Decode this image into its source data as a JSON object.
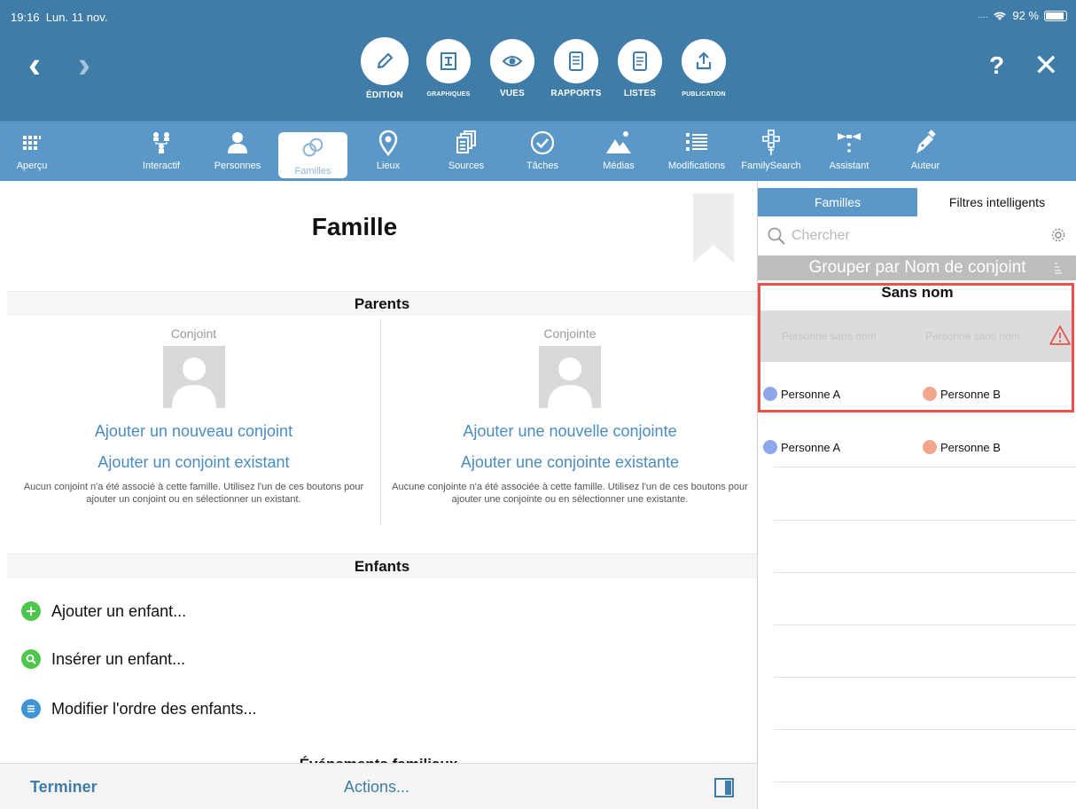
{
  "status": {
    "time": "19:16",
    "date": "Lun. 11 nov.",
    "battery": "92 %",
    "battery_level": 0.92
  },
  "header": {
    "modes": [
      {
        "label": "ÉDITION",
        "icon": "pencil-icon",
        "active": true
      },
      {
        "label": "GRAPHIQUES",
        "icon": "chart-icon",
        "active": false
      },
      {
        "label": "VUES",
        "icon": "eye-icon",
        "active": false
      },
      {
        "label": "RAPPORTS",
        "icon": "document-icon",
        "active": false
      },
      {
        "label": "LISTES",
        "icon": "list-document-icon",
        "active": false
      },
      {
        "label": "PUBLICATION",
        "icon": "share-icon",
        "active": false
      }
    ],
    "help": "?",
    "close": "✕"
  },
  "toolbar": {
    "items": [
      {
        "label": "Aperçu",
        "icon": "grid-icon"
      },
      {
        "label": "Interactif",
        "icon": "tree-icon"
      },
      {
        "label": "Personnes",
        "icon": "person-icon"
      },
      {
        "label": "Familles",
        "icon": "rings-icon",
        "active": true
      },
      {
        "label": "Lieux",
        "icon": "pin-icon"
      },
      {
        "label": "Sources",
        "icon": "sources-icon"
      },
      {
        "label": "Tâches",
        "icon": "check-icon"
      },
      {
        "label": "Médias",
        "icon": "media-icon"
      },
      {
        "label": "Modifications",
        "icon": "changes-icon"
      },
      {
        "label": "FamilySearch",
        "icon": "familysearch-icon"
      },
      {
        "label": "Assistant",
        "icon": "bowtie-icon"
      },
      {
        "label": "Auteur",
        "icon": "pen-icon"
      }
    ]
  },
  "main": {
    "title": "Famille",
    "parents_header": "Parents",
    "left": {
      "role": "Conjoint",
      "add_new": "Ajouter un nouveau conjoint",
      "add_existing": "Ajouter un conjoint existant",
      "hint": "Aucun conjoint n'a été associé à cette famille. Utilisez l'un de ces boutons pour ajouter un conjoint ou en sélectionner un existant."
    },
    "right": {
      "role": "Conjointe",
      "add_new": "Ajouter une nouvelle conjointe",
      "add_existing": "Ajouter une conjointe existante",
      "hint": "Aucune conjointe n'a été associée à cette famille. Utilisez l'un de ces boutons pour ajouter une conjointe ou en sélectionner une existante."
    },
    "children_header": "Enfants",
    "add_child": "Ajouter un enfant...",
    "insert_child": "Insérer un enfant...",
    "reorder_children": "Modifier l'ordre des enfants...",
    "events_header": "Événements familiaux"
  },
  "bottom": {
    "done": "Terminer",
    "actions": "Actions..."
  },
  "sidebar": {
    "tab_families": "Familles",
    "tab_filters": "Filtres intelligents",
    "search_placeholder": "Chercher",
    "group_by": "Grouper par Nom de conjoint",
    "group_title": "Sans nom",
    "unnamed_row": {
      "a": "Personne sans nom",
      "b": "Personne sans nom"
    },
    "rows": [
      {
        "a": "Personne A",
        "b": "Personne B"
      },
      {
        "a": "Personne A",
        "b": "Personne B"
      }
    ]
  },
  "colors": {
    "header": "#3f7ca8",
    "toolbar": "#5b98c8",
    "link": "#4a8cc0",
    "male": "#8ea6ea",
    "female": "#f2a68c",
    "highlight": "#e8524a"
  }
}
